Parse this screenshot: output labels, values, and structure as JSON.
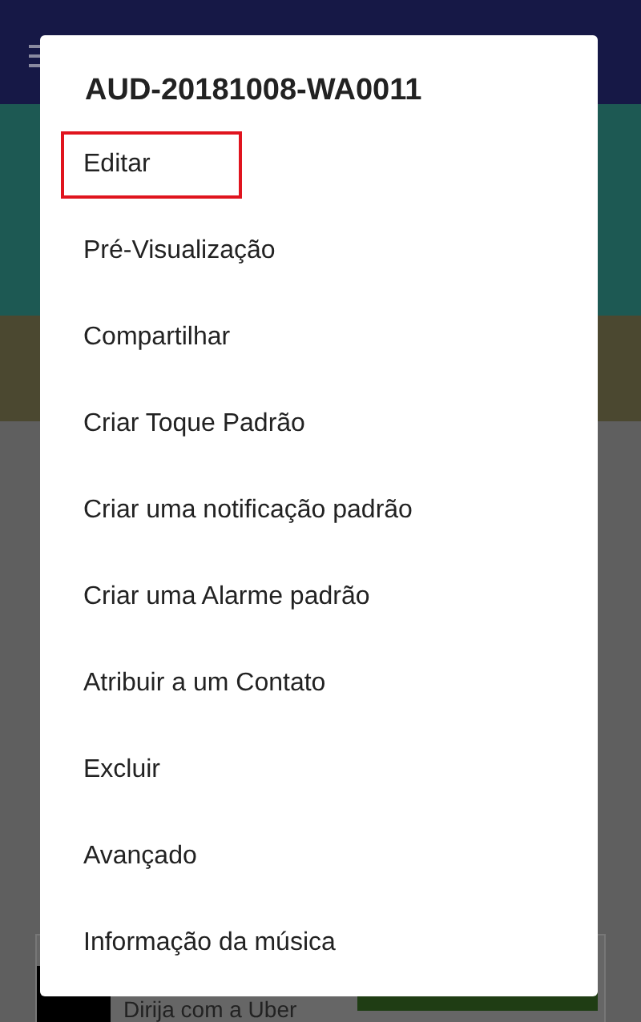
{
  "dialog": {
    "title": "AUD-20181008-WA0011",
    "items": [
      {
        "label": "Editar",
        "highlighted": true
      },
      {
        "label": "Pré-Visualização",
        "highlighted": false
      },
      {
        "label": "Compartilhar",
        "highlighted": false
      },
      {
        "label": "Criar Toque Padrão",
        "highlighted": false
      },
      {
        "label": "Criar uma notificação padrão",
        "highlighted": false
      },
      {
        "label": "Criar uma Alarme padrão",
        "highlighted": false
      },
      {
        "label": "Atribuir a um Contato",
        "highlighted": false
      },
      {
        "label": "Excluir",
        "highlighted": false
      },
      {
        "label": "Avançado",
        "highlighted": false
      },
      {
        "label": "Informação da música",
        "highlighted": false
      }
    ]
  },
  "ad": {
    "text": "Dirija com a Uber"
  }
}
